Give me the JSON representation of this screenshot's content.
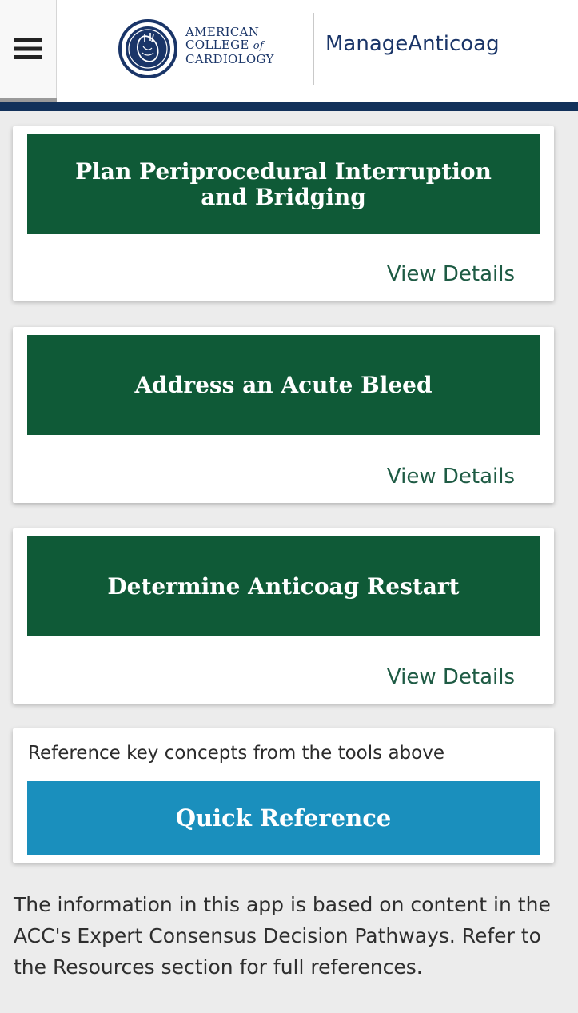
{
  "header": {
    "menu_icon": "hamburger-menu-icon",
    "logo": {
      "line1": "AMERICAN",
      "line2_prefix": "COLLEGE ",
      "line2_of": "of",
      "line3": "CARDIOLOGY"
    },
    "app_title": "ManageAnticoag"
  },
  "cards": [
    {
      "title": "Plan Periprocedural Interruption and Bridging",
      "link": "View Details"
    },
    {
      "title": "Address an Acute Bleed",
      "link": "View Details"
    },
    {
      "title": "Determine Anticoag Restart",
      "link": "View Details"
    }
  ],
  "reference": {
    "intro": "Reference key concepts from the tools above",
    "button": "Quick Reference"
  },
  "footer": {
    "text": "The information in this app is based on content in the ACC's Expert Consensus Decision Pathways. Refer to the Resources section for full references."
  },
  "colors": {
    "header_rule": "#12315a",
    "card_banner": "#0f5a37",
    "link": "#1e5b44",
    "quick_reference": "#1a8fbd",
    "brand_text": "#1a3568"
  }
}
